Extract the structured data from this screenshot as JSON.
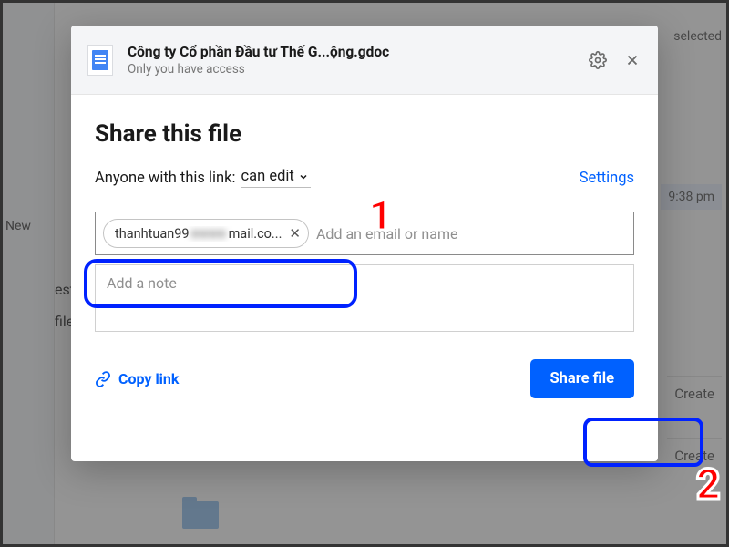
{
  "background": {
    "left_label": "New",
    "mid_items": [
      "ests",
      "files"
    ],
    "right": {
      "selected": "selected",
      "time": "9:38 pm",
      "row1": "Create",
      "row2": "Create"
    }
  },
  "modal": {
    "header": {
      "title": "Công ty Cổ phần Đầu tư Thế G...ộng.gdoc",
      "subtitle": "Only you have access"
    },
    "body_title": "Share this file",
    "perm": {
      "prefix": "Anyone with this link:",
      "value": "can edit",
      "settings": "Settings"
    },
    "email": {
      "chip_prefix": "thanhtuan99",
      "chip_suffix": "mail.co...",
      "chip_hidden": "■■■■",
      "placeholder": "Add an email or name"
    },
    "note_placeholder": "Add a note",
    "copy_link": "Copy link",
    "share_button": "Share file"
  },
  "annotations": {
    "num1": "1",
    "num2": "2"
  }
}
